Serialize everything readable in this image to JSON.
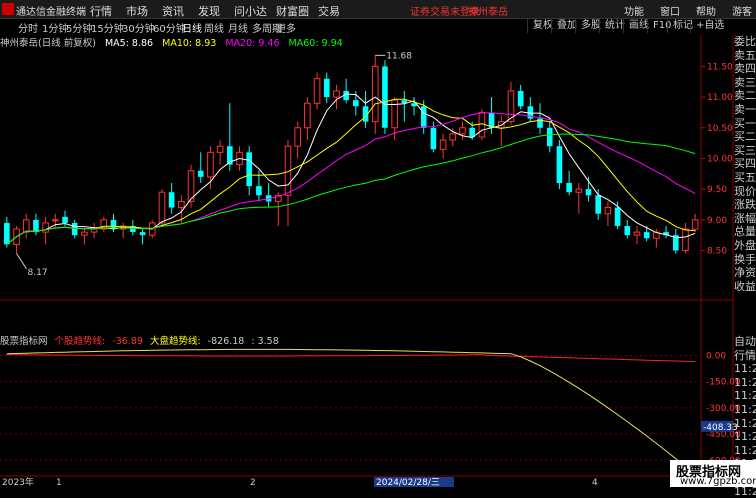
{
  "app": {
    "title": "通达信金融终端",
    "login_warning": "证券交易未登录",
    "stock": "神州泰岳"
  },
  "menu": [
    "行情",
    "市场",
    "资讯",
    "发现",
    "问小达",
    "财富圈",
    "交易"
  ],
  "right_menu": [
    "功能",
    "窗口",
    "帮助",
    "游客"
  ],
  "periods": [
    "分时",
    "1分钟",
    "5分钟",
    "15分钟",
    "30分钟",
    "60分钟",
    "日线",
    "周线",
    "月线",
    "多周期",
    "更多"
  ],
  "active_period": "日线",
  "toolbar_buttons": [
    "复权",
    "叠加",
    "多股",
    "统计",
    "画线",
    "F10",
    "标记",
    "+自选"
  ],
  "chart_header": {
    "name": "神州泰岳(日线 前复权)",
    "ma5": "MA5: 8.86",
    "ma10": "MA10: 8.93",
    "ma20": "MA20: 9.46",
    "ma60": "MA60: 9.94"
  },
  "price_axis": [
    "11.50",
    "11.00",
    "10.50",
    "10.00",
    "9.50",
    "9.00",
    "8.50"
  ],
  "price_marks": {
    "high": "11.68",
    "low": "8.17"
  },
  "side_panel": [
    "委比",
    "卖五",
    "卖四",
    "卖三",
    "卖二",
    "卖一",
    "买一",
    "买二",
    "买三",
    "买四",
    "买五",
    "现价",
    "涨跌",
    "涨幅",
    "总量",
    "外盘",
    "换手",
    "净资",
    "收益"
  ],
  "side_panel2": [
    "自动",
    "行情",
    "11:26",
    "11:26",
    "11:26",
    "11:26",
    "11:26",
    "11:26",
    "11:26",
    "11:26",
    "11:26",
    "11:26"
  ],
  "indicator": {
    "source": "股票指标网",
    "line1_name": "个股趋势线:",
    "line1_value": "-36.89",
    "line2_name": "大盘趋势线:",
    "line2_value": "-826.18",
    "extra": ": 3.58",
    "axis": [
      "0.00",
      "-150.00",
      "-300.00",
      "-450.00",
      "-600.00"
    ],
    "current_tag": "-408.33"
  },
  "x_axis": {
    "year": "2023年",
    "m1": "1",
    "m2": "2",
    "date": "2024/02/28/三",
    "m4": "4"
  },
  "watermark": {
    "line1": "股票指标网",
    "line2": "www.7gpzb.com"
  },
  "colors": {
    "up": "#ff3232",
    "down": "#00ffff",
    "ma5": "#ffffff",
    "ma10": "#ffff00",
    "ma20": "#ff00ff",
    "ma60": "#00ff00"
  },
  "chart_data": {
    "type": "candlestick",
    "ohlc": [
      [
        8.95,
        9.05,
        8.55,
        8.6
      ],
      [
        8.6,
        8.9,
        8.45,
        8.85
      ],
      [
        8.8,
        9.1,
        8.7,
        9.0
      ],
      [
        9.0,
        9.1,
        8.75,
        8.8
      ],
      [
        8.8,
        9.05,
        8.6,
        8.95
      ],
      [
        9.0,
        9.1,
        8.85,
        9.0
      ],
      [
        9.05,
        9.15,
        8.9,
        8.95
      ],
      [
        8.95,
        9.0,
        8.7,
        8.75
      ],
      [
        8.75,
        8.85,
        8.6,
        8.8
      ],
      [
        8.8,
        8.95,
        8.7,
        8.85
      ],
      [
        8.85,
        9.05,
        8.8,
        9.0
      ],
      [
        9.0,
        9.1,
        8.8,
        8.85
      ],
      [
        8.85,
        8.95,
        8.7,
        8.9
      ],
      [
        8.9,
        9.0,
        8.75,
        8.8
      ],
      [
        8.8,
        8.85,
        8.6,
        8.75
      ],
      [
        8.75,
        9.0,
        8.7,
        8.95
      ],
      [
        8.95,
        9.5,
        8.9,
        9.45
      ],
      [
        9.45,
        9.6,
        9.1,
        9.2
      ],
      [
        9.2,
        9.4,
        8.95,
        9.3
      ],
      [
        9.3,
        9.9,
        9.2,
        9.8
      ],
      [
        9.8,
        10.1,
        9.6,
        9.7
      ],
      [
        9.7,
        10.2,
        9.5,
        10.1
      ],
      [
        10.1,
        10.3,
        9.9,
        10.2
      ],
      [
        10.2,
        10.9,
        9.8,
        9.9
      ],
      [
        9.9,
        10.2,
        9.8,
        10.1
      ],
      [
        10.1,
        10.2,
        9.4,
        9.55
      ],
      [
        9.55,
        9.8,
        9.3,
        9.4
      ],
      [
        9.4,
        9.6,
        9.2,
        9.3
      ],
      [
        9.3,
        9.45,
        8.9,
        9.4
      ],
      [
        9.4,
        10.3,
        8.9,
        10.2
      ],
      [
        10.2,
        10.6,
        10.0,
        10.5
      ],
      [
        10.5,
        11.0,
        10.3,
        10.9
      ],
      [
        10.9,
        11.4,
        10.8,
        11.3
      ],
      [
        11.3,
        11.4,
        10.9,
        11.0
      ],
      [
        11.0,
        11.2,
        10.8,
        11.1
      ],
      [
        11.1,
        11.3,
        10.9,
        10.95
      ],
      [
        10.95,
        11.1,
        10.7,
        10.85
      ],
      [
        10.85,
        11.1,
        10.5,
        10.6
      ],
      [
        10.6,
        11.68,
        10.4,
        11.5
      ],
      [
        11.5,
        11.6,
        10.4,
        10.5
      ],
      [
        10.5,
        11.0,
        10.3,
        10.95
      ],
      [
        10.95,
        11.1,
        10.6,
        10.9
      ],
      [
        10.9,
        11.0,
        10.7,
        10.85
      ],
      [
        10.85,
        10.95,
        10.4,
        10.5
      ],
      [
        10.5,
        10.6,
        10.1,
        10.15
      ],
      [
        10.15,
        10.4,
        10.0,
        10.3
      ],
      [
        10.3,
        10.5,
        10.2,
        10.4
      ],
      [
        10.4,
        10.6,
        10.3,
        10.5
      ],
      [
        10.5,
        10.6,
        10.3,
        10.35
      ],
      [
        10.35,
        10.8,
        10.3,
        10.75
      ],
      [
        10.75,
        11.0,
        10.4,
        10.5
      ],
      [
        10.5,
        10.7,
        10.2,
        10.6
      ],
      [
        10.6,
        11.25,
        10.55,
        11.1
      ],
      [
        11.1,
        11.2,
        10.8,
        10.85
      ],
      [
        10.85,
        11.0,
        10.6,
        10.65
      ],
      [
        10.65,
        10.9,
        10.4,
        10.5
      ],
      [
        10.5,
        10.6,
        10.1,
        10.2
      ],
      [
        10.2,
        10.3,
        9.5,
        9.6
      ],
      [
        9.6,
        9.8,
        9.4,
        9.45
      ],
      [
        9.45,
        9.6,
        9.1,
        9.5
      ],
      [
        9.5,
        9.7,
        9.3,
        9.4
      ],
      [
        9.4,
        9.5,
        9.0,
        9.1
      ],
      [
        9.1,
        9.3,
        8.9,
        9.2
      ],
      [
        9.2,
        9.3,
        8.85,
        8.9
      ],
      [
        8.9,
        9.0,
        8.7,
        8.75
      ],
      [
        8.75,
        8.9,
        8.6,
        8.8
      ],
      [
        8.8,
        8.9,
        8.65,
        8.7
      ],
      [
        8.7,
        8.85,
        8.55,
        8.8
      ],
      [
        8.8,
        8.9,
        8.7,
        8.75
      ],
      [
        8.75,
        8.85,
        8.45,
        8.5
      ],
      [
        8.5,
        8.95,
        8.45,
        8.85
      ],
      [
        8.85,
        9.1,
        8.8,
        9.0
      ]
    ],
    "ylim": [
      8.15,
      11.8
    ],
    "ind_ylim": [
      -690,
      60
    ]
  }
}
